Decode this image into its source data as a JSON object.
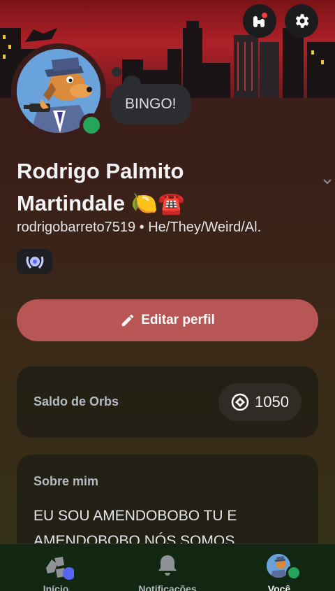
{
  "header": {
    "quests_button_icon": "nitro-quests-icon",
    "settings_button_icon": "gear-icon"
  },
  "profile": {
    "status_bubble": "BINGO!",
    "display_name_line1": "Rodrigo Palmito",
    "display_name_line2": "Martindale 🍋☎️",
    "subtitle": "rodrigobarreto7519 • He/They/Weird/Al.",
    "status": "online",
    "edit_button_label": "Editar perfil"
  },
  "orbs": {
    "label": "Saldo de Orbs",
    "value": "1050"
  },
  "about": {
    "title": "Sobre mim",
    "text": "EU SOU AMENDOBOBO TU E AMENDOBOBO NÓS SOMOS"
  },
  "bottom_nav": {
    "items": [
      {
        "label": "Início",
        "icon": "servers-icon"
      },
      {
        "label": "Notificações",
        "icon": "bell-icon"
      },
      {
        "label": "Você",
        "icon": "avatar"
      }
    ]
  },
  "colors": {
    "online": "#23a55a",
    "edit_button": "#b85555",
    "unread_dot": "#5865f2"
  }
}
